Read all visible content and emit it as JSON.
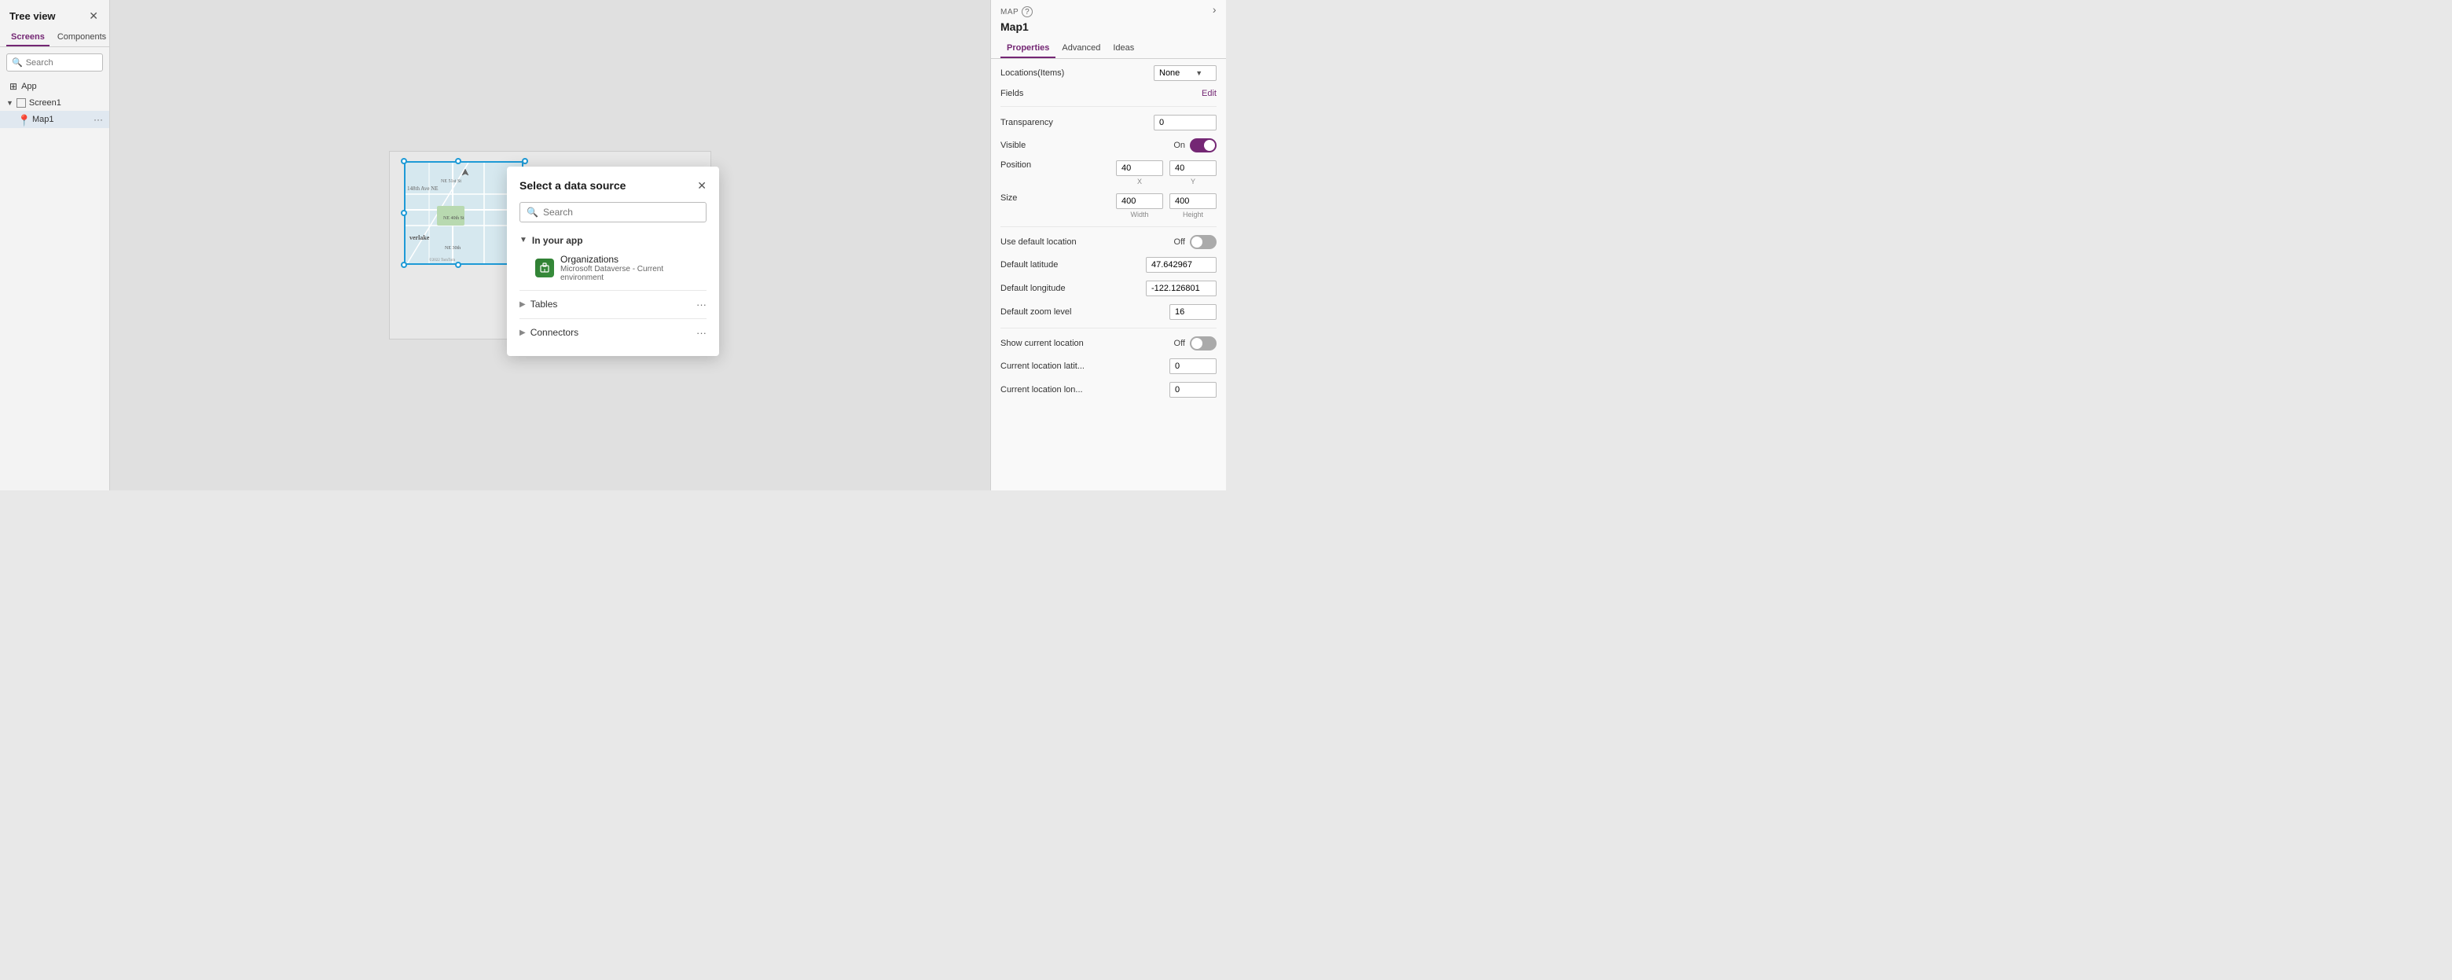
{
  "leftPanel": {
    "title": "Tree view",
    "tabs": [
      {
        "id": "screens",
        "label": "Screens",
        "active": true
      },
      {
        "id": "components",
        "label": "Components",
        "active": false
      }
    ],
    "search": {
      "placeholder": "Search",
      "value": ""
    },
    "tree": {
      "appLabel": "App",
      "screen1Label": "Screen1",
      "mapLabel": "Map1"
    }
  },
  "modal": {
    "title": "Select a data source",
    "search": {
      "placeholder": "Search",
      "value": ""
    },
    "inYourApp": "In your app",
    "organizations": {
      "name": "Organizations",
      "sub": "Microsoft Dataverse - Current environment"
    },
    "tables": "Tables",
    "connectors": "Connectors"
  },
  "rightPanel": {
    "mapTag": "MAP",
    "mapName": "Map1",
    "tabs": [
      {
        "id": "properties",
        "label": "Properties",
        "active": true
      },
      {
        "id": "advanced",
        "label": "Advanced",
        "active": false
      },
      {
        "id": "ideas",
        "label": "Ideas",
        "active": false
      }
    ],
    "properties": {
      "locationsItemsLabel": "Locations(Items)",
      "locationsItemsValue": "None",
      "fieldsLabel": "Fields",
      "fieldsValue": "Edit",
      "transparencyLabel": "Transparency",
      "transparencyValue": "0",
      "visibleLabel": "Visible",
      "visibleToggle": "On",
      "positionLabel": "Position",
      "positionX": "40",
      "positionY": "40",
      "positionXLabel": "X",
      "positionYLabel": "Y",
      "sizeLabel": "Size",
      "sizeWidth": "400",
      "sizeHeight": "400",
      "sizeWidthLabel": "Width",
      "sizeHeightLabel": "Height",
      "useDefaultLocationLabel": "Use default location",
      "useDefaultLocationToggle": "Off",
      "defaultLatitudeLabel": "Default latitude",
      "defaultLatitudeValue": "47.642967",
      "defaultLongitudeLabel": "Default longitude",
      "defaultLongitudeValue": "-122.126801",
      "defaultZoomLevelLabel": "Default zoom level",
      "defaultZoomLevelValue": "16",
      "showCurrentLocationLabel": "Show current location",
      "showCurrentLocationToggle": "Off",
      "currentLocationLatLabel": "Current location latit...",
      "currentLocationLatValue": "0",
      "currentLocationLonLabel": "Current location lon...",
      "currentLocationLonValue": "0"
    }
  }
}
